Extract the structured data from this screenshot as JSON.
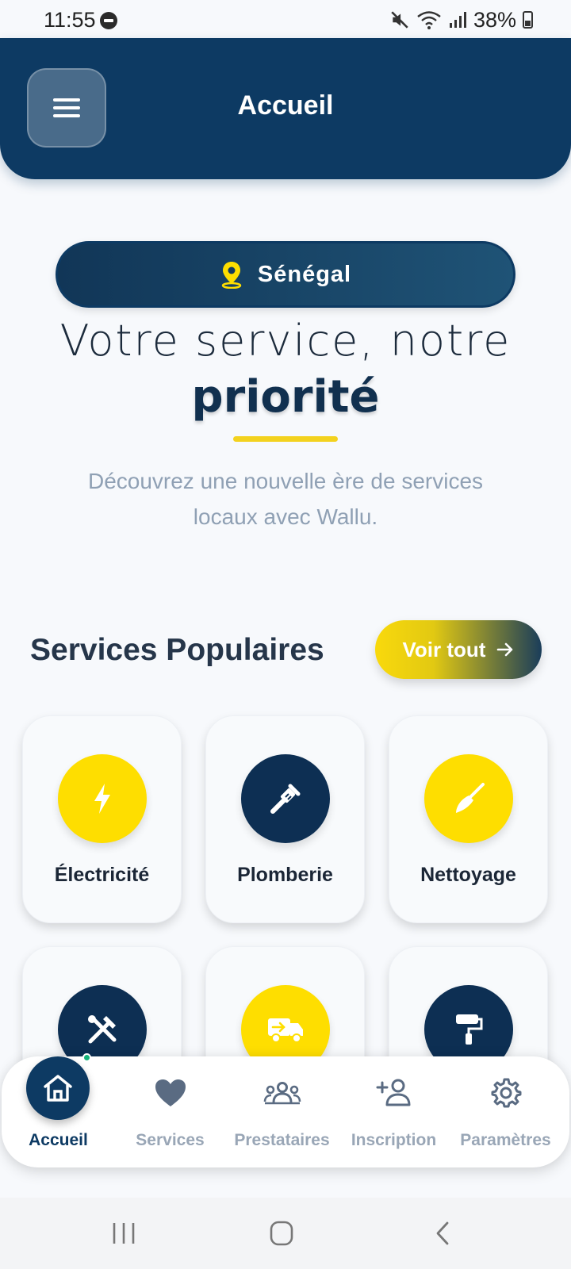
{
  "status_bar": {
    "time": "11:55",
    "battery": "38%"
  },
  "header": {
    "title": "Accueil"
  },
  "location": {
    "label": "Sénégal"
  },
  "hero": {
    "line1": "Votre service, notre",
    "line2": "priorité",
    "description": "Découvrez une nouvelle ère de services locaux avec Wallu."
  },
  "section": {
    "title": "Services Populaires",
    "see_all_label": "Voir tout"
  },
  "services": [
    {
      "label": "Électricité",
      "icon": "lightning-icon",
      "color": "#fede00"
    },
    {
      "label": "Plomberie",
      "icon": "wrench-icon",
      "color": "#0d2f53"
    },
    {
      "label": "Nettoyage",
      "icon": "broom-icon",
      "color": "#fede00"
    },
    {
      "label": "",
      "icon": "tools-icon",
      "color": "#0d2f53"
    },
    {
      "label": "",
      "icon": "truck-icon",
      "color": "#fede00"
    },
    {
      "label": "",
      "icon": "paint-roller-icon",
      "color": "#0d2f53"
    }
  ],
  "bottom_nav": [
    {
      "label": "Accueil",
      "icon": "home-icon",
      "active": true
    },
    {
      "label": "Services",
      "icon": "heart-icon",
      "active": false
    },
    {
      "label": "Prestataires",
      "icon": "users-icon",
      "active": false
    },
    {
      "label": "Inscription",
      "icon": "user-plus-icon",
      "active": false
    },
    {
      "label": "Paramètres",
      "icon": "gear-icon",
      "active": false
    }
  ],
  "colors": {
    "primary": "#0d3a63",
    "accent": "#fede00",
    "muted": "#99a6b6"
  }
}
